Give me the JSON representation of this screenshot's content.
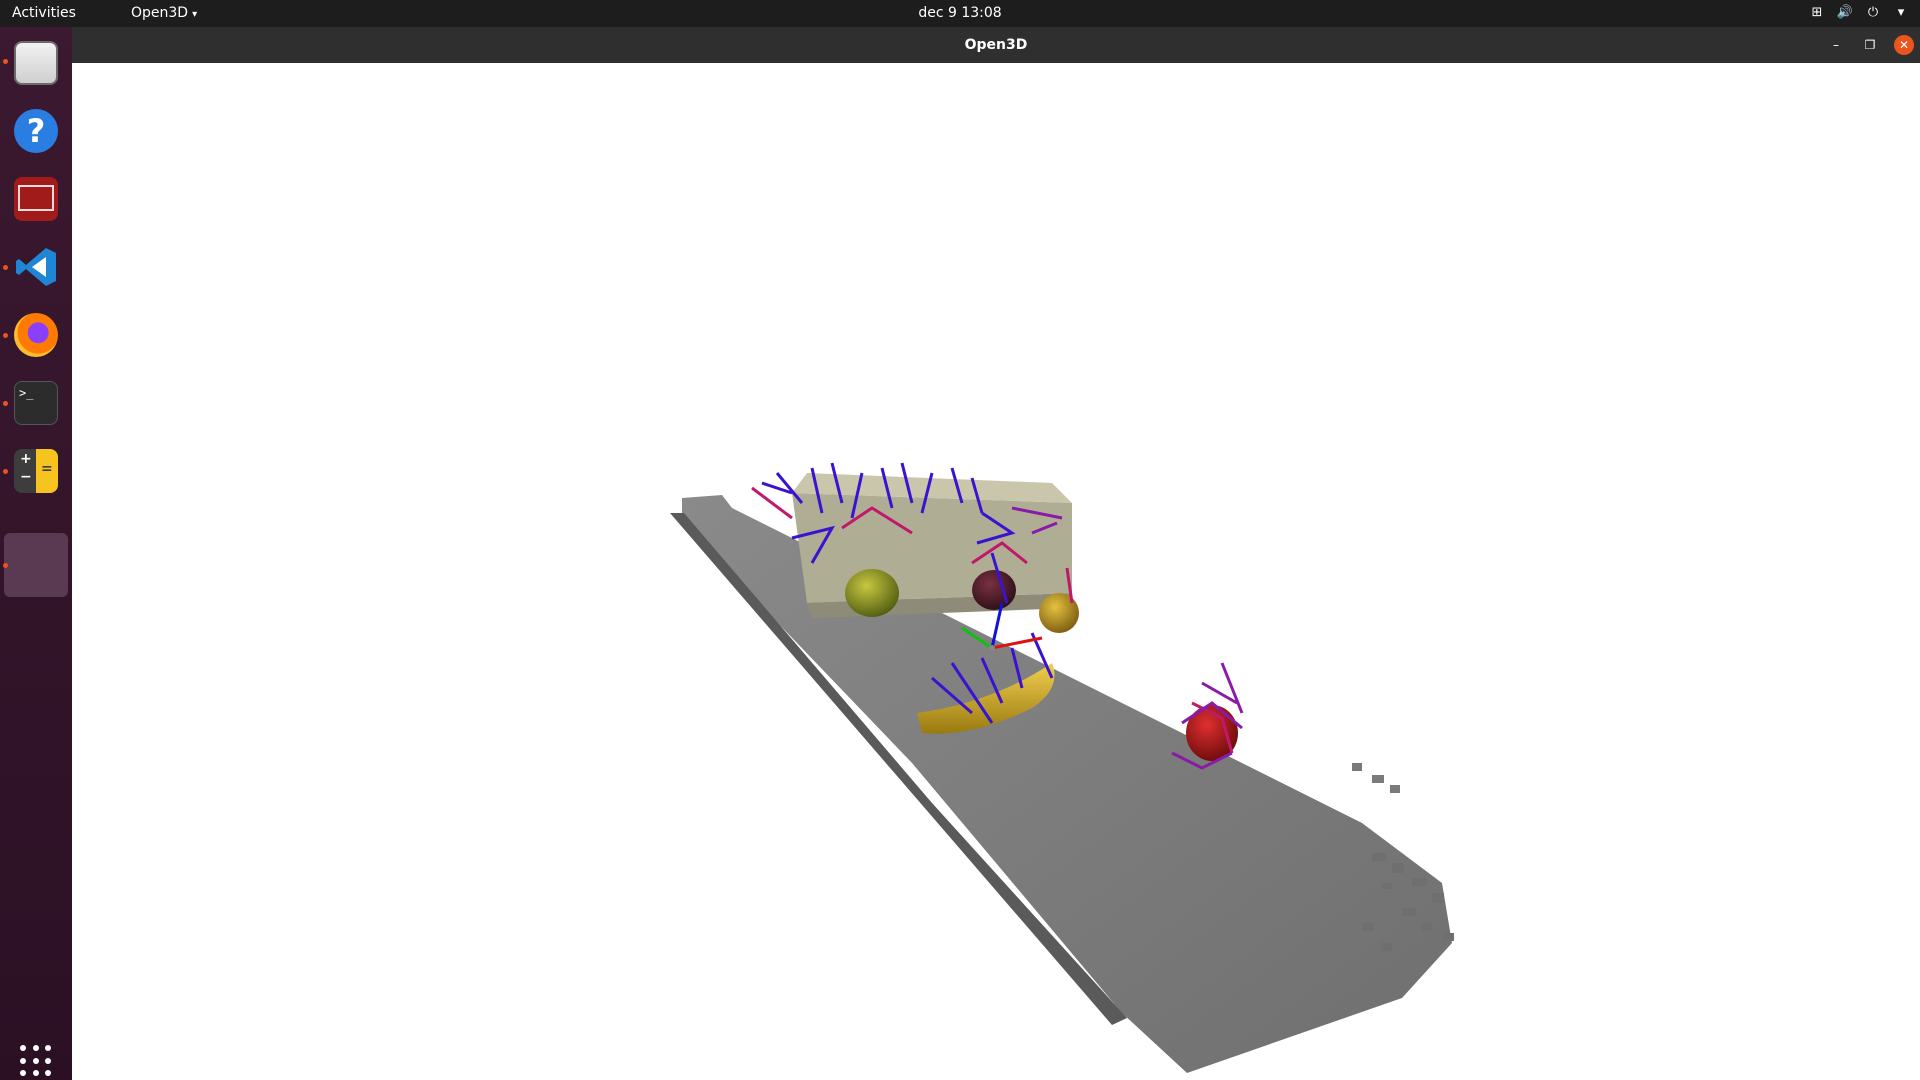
{
  "topbar": {
    "activities": "Activities",
    "app_menu": "Open3D",
    "caret": "▾",
    "datetime": "dec 9  13:08",
    "tray_network": "⊞",
    "tray_volume": "🔊",
    "tray_power": "⏻",
    "tray_caret": "▾"
  },
  "dock": {
    "help_glyph": "?",
    "terminal_glyph": ">_",
    "calc_plus": "+",
    "calc_minus": "−",
    "calc_equals": "="
  },
  "window": {
    "title": "Open3D",
    "min_glyph": "–",
    "max_glyph": "❐",
    "close_glyph": "✕"
  },
  "colors": {
    "topbar": "#1d1d1d",
    "dock": "#2b1024",
    "accent": "#e95420",
    "titlebar": "#2f2f2f",
    "floor": "#7a7a7a"
  }
}
